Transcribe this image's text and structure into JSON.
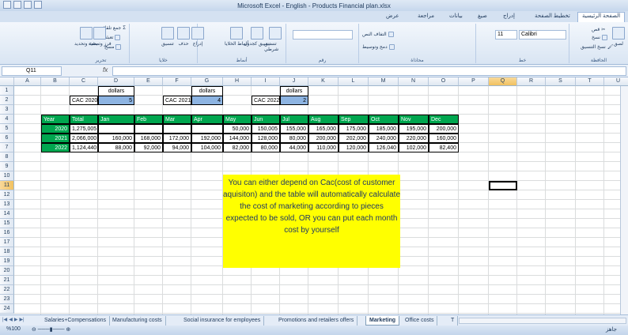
{
  "window": {
    "title": "Microsoft Excel - English - Products Financial plan.xlsx"
  },
  "ribbon": {
    "tabs": [
      "عرض",
      "مراجعة",
      "بيانات",
      "صيغ",
      "إدراج",
      "تخطيط الصفحة",
      "الصفحة الرئيسية"
    ],
    "active_tab": "الصفحة الرئيسية",
    "groups": {
      "editing": "تحرير",
      "cells": "خلايا",
      "styles": "أنماط",
      "number": "رقم",
      "alignment": "محاذاة",
      "font": "خط",
      "clipboard": "الحافظة"
    },
    "buttons": {
      "autosum": "جمع تلقائي",
      "fill": "تعبئة",
      "clear": "مسح",
      "sort_filter": "فرز وتصفية",
      "find_select": "بحث وتحديد",
      "format": "تنسيق",
      "delete": "حذف",
      "insert": "إدراج",
      "cell_styles": "أنماط الخلايا",
      "format_table": "تنسيق كجدول",
      "cond_format": "تنسيق شرطي",
      "wrap_text": "التفاف النص",
      "merge_center": "دمج وتوسيط",
      "cut": "قص",
      "copy": "نسخ",
      "format_painter": "نسخ التنسيق",
      "paste": "لصق"
    },
    "font_name": "Calibri",
    "font_size": "11"
  },
  "formula_bar": {
    "name_box": "Q11",
    "fx": "fx",
    "content": ""
  },
  "columns": [
    "A",
    "B",
    "C",
    "D",
    "E",
    "F",
    "G",
    "H",
    "I",
    "J",
    "K",
    "L",
    "M",
    "N",
    "O",
    "P",
    "Q",
    "R",
    "S",
    "T",
    "U"
  ],
  "rows": [
    "1",
    "2",
    "3",
    "4",
    "5",
    "6",
    "7",
    "8",
    "9",
    "10",
    "11",
    "12",
    "13",
    "14",
    "15",
    "16",
    "17",
    "18",
    "19",
    "20",
    "21",
    "22",
    "23",
    "24"
  ],
  "selected_cell": {
    "column": "Q",
    "row": "11"
  },
  "cac": [
    {
      "label": "CAC 2020",
      "unit": "dollars",
      "value": "5"
    },
    {
      "label": "CAC 2021",
      "unit": "dollars",
      "value": "4"
    },
    {
      "label": "CAC 2022",
      "unit": "dollars",
      "value": "2"
    }
  ],
  "table": {
    "headers": [
      "Year",
      "Total",
      "Jan",
      "Feb",
      "Mar",
      "Apr",
      "May",
      "Jun",
      "Jul",
      "Aug",
      "Sep",
      "Oct",
      "Nov",
      "Dec"
    ],
    "rows": [
      [
        "2020",
        "1,275,005",
        "",
        "",
        "",
        "",
        "50,000",
        "150,005",
        "155,000",
        "165,000",
        "175,000",
        "185,000",
        "195,000",
        "200,000"
      ],
      [
        "2021",
        "2,066,000",
        "160,000",
        "168,000",
        "172,000",
        "192,000",
        "144,000",
        "128,000",
        "80,000",
        "200,000",
        "202,000",
        "240,000",
        "220,000",
        "160,000"
      ],
      [
        "2022",
        "1,124,440",
        "88,000",
        "92,000",
        "94,000",
        "104,000",
        "82,000",
        "80,000",
        "44,000",
        "110,000",
        "120,000",
        "126,040",
        "102,000",
        "82,400"
      ]
    ]
  },
  "note": {
    "text": "You can either depend on Cac(cost of customer aquisiton) and the table will automatically calculate the cost of marketing according to pieces expected to be sold, OR you can put each month cost by yourself"
  },
  "sheets": [
    "Salaries+Compensations",
    "Manufacturing costs",
    "Social insurance for employees",
    "Promotions and retailers offers",
    "Marketing",
    "Office costs",
    "T"
  ],
  "active_sheet": "Marketing",
  "status": {
    "ready": "جاهز",
    "zoom": "%100"
  }
}
